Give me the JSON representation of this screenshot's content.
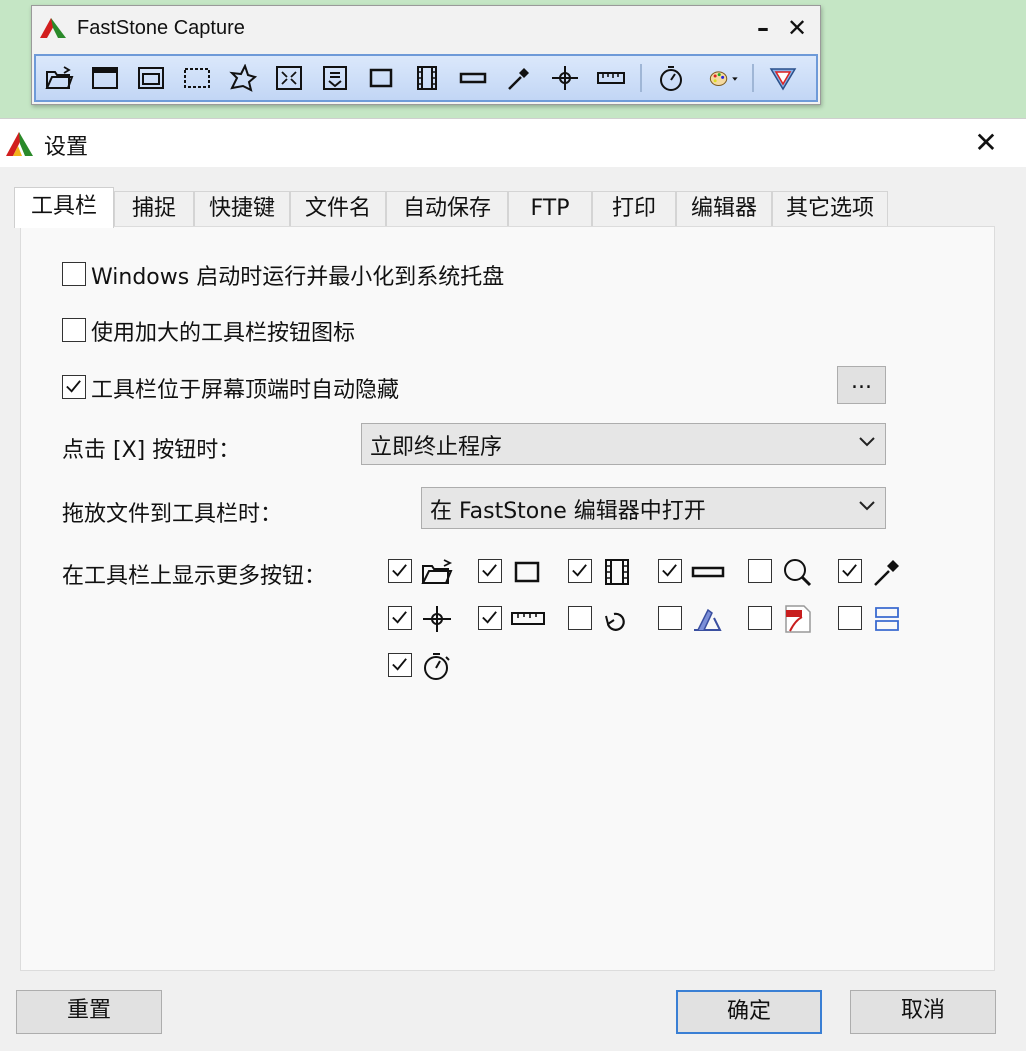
{
  "capture_window": {
    "title": "FastStone Capture",
    "minimize_label": "–",
    "close_label": "✕",
    "tools": [
      "open-folder-icon",
      "capture-window-icon",
      "capture-object-icon",
      "capture-rectangle-icon",
      "capture-freehand-icon",
      "capture-fullscreen-icon",
      "capture-scrolling-icon",
      "capture-fixed-region-icon",
      "screen-recorder-icon",
      "capture-bar-icon",
      "color-picker-icon",
      "crosshair-icon",
      "ruler-icon",
      "timer-icon",
      "palette-dropdown-icon",
      "settings-icon"
    ]
  },
  "dialog": {
    "title": "设置",
    "close_label": "✕",
    "tabs": [
      "工具栏",
      "捕捉",
      "快捷键",
      "文件名",
      "自动保存",
      "FTP",
      "打印",
      "编辑器",
      "其它选项"
    ],
    "active_tab": "工具栏",
    "options": [
      {
        "label": "Windows 启动时运行并最小化到系统托盘",
        "checked": false
      },
      {
        "label": "使用加大的工具栏按钮图标",
        "checked": false
      },
      {
        "label": "工具栏位于屏幕顶端时自动隐藏",
        "checked": true
      }
    ],
    "ellipsis_label": "...",
    "close_action": {
      "label": "点击 [X] 按钮时：",
      "value": "立即终止程序"
    },
    "drop_action": {
      "label": "拖放文件到工具栏时：",
      "value": "在 FastStone 编辑器中打开"
    },
    "more_buttons_label": "在工具栏上显示更多按钮：",
    "more_buttons": [
      {
        "icon": "open-folder-icon",
        "checked": true
      },
      {
        "icon": "fixed-region-icon",
        "checked": true
      },
      {
        "icon": "film-recorder-icon",
        "checked": true
      },
      {
        "icon": "capture-bar-icon",
        "checked": true
      },
      {
        "icon": "magnifier-icon",
        "checked": false
      },
      {
        "icon": "color-picker-icon",
        "checked": true
      },
      {
        "icon": "crosshair-icon",
        "checked": true
      },
      {
        "icon": "ruler-icon",
        "checked": true
      },
      {
        "icon": "repeat-last-icon",
        "checked": false
      },
      {
        "icon": "scanner-icon",
        "checked": false
      },
      {
        "icon": "pdf-icon",
        "checked": false
      },
      {
        "icon": "split-window-icon",
        "checked": false
      },
      {
        "icon": "timer-icon",
        "checked": true
      }
    ],
    "reset_label": "重置",
    "ok_label": "确定",
    "cancel_label": "取消"
  }
}
